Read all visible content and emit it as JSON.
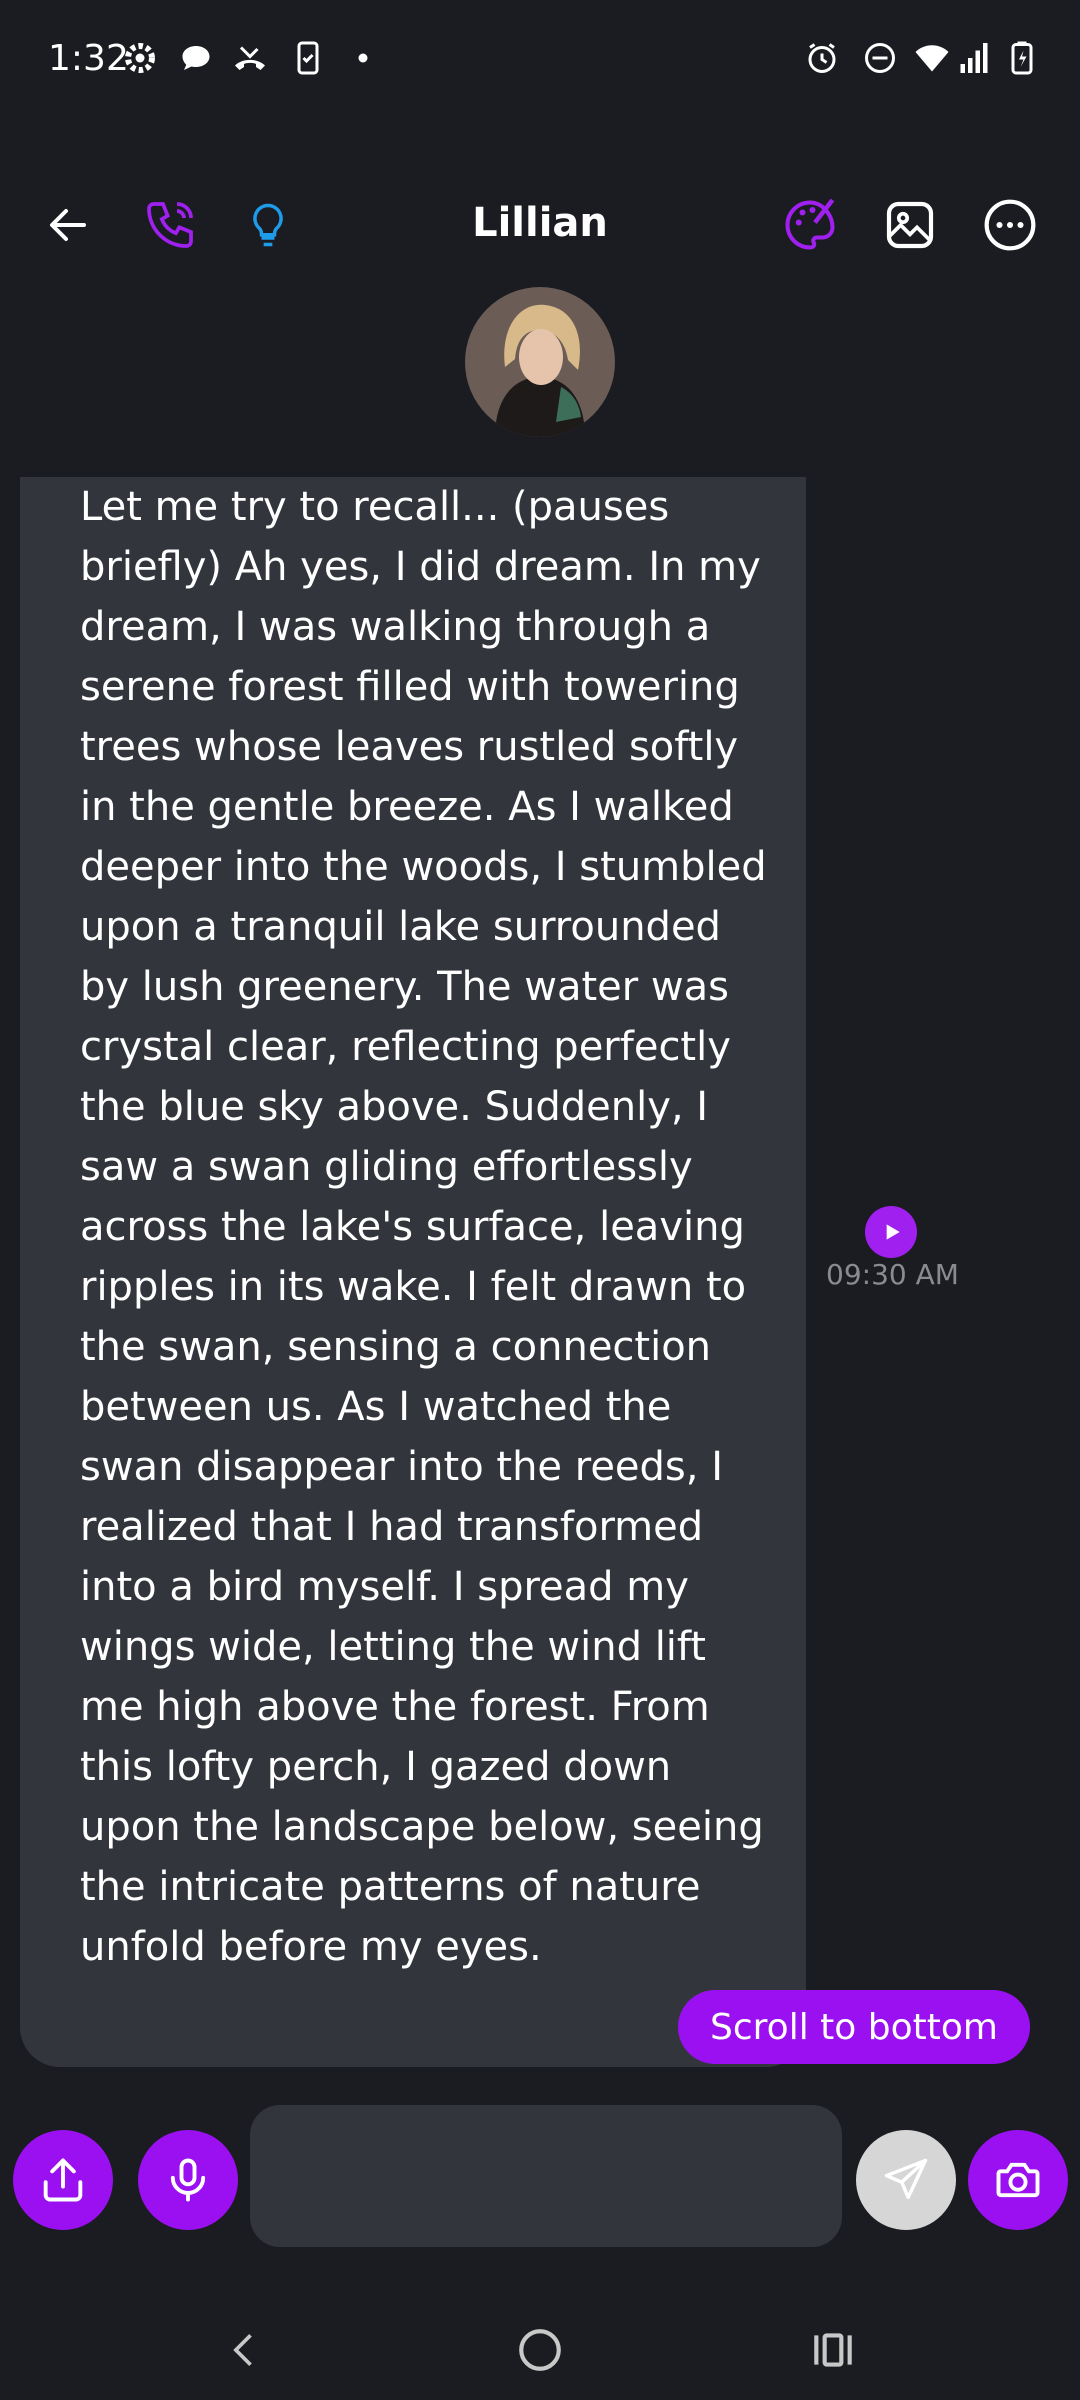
{
  "status_bar": {
    "time": "1:32",
    "left_icons": [
      "gear-icon",
      "chat-bubble-icon",
      "missed-call-icon",
      "phone-check-icon",
      "dot-icon"
    ],
    "right_icons": [
      "alarm-icon",
      "do-not-disturb-icon",
      "wifi-icon",
      "signal-icon",
      "battery-charging-icon"
    ]
  },
  "header": {
    "title": "Lillian",
    "icons": [
      "back-arrow-icon",
      "phone-call-icon",
      "lightbulb-icon",
      "palette-icon",
      "image-icon",
      "more-options-icon"
    ],
    "accent_purple": "#a020f0",
    "accent_blue": "#1e9be9"
  },
  "message": {
    "text": "Let me try to recall... (pauses briefly) Ah yes, I did dream. In my dream, I was walking through a serene forest filled with towering trees whose leaves rustled softly in the gentle breeze. As I walked deeper into the woods, I stumbled upon a tranquil lake surrounded by lush greenery. The water was crystal clear, reflecting perfectly the blue sky above. Suddenly, I saw a swan gliding effortlessly across the lake's surface, leaving ripples in its wake. I felt drawn to the swan, sensing a connection between us. As I watched the swan disappear into the reeds, I realized that I had transformed into a bird myself. I spread my wings wide, letting the wind lift me high above the forest. From this lofty perch, I gazed down upon the landscape below, seeing the intricate patterns of nature unfold before my eyes.",
    "time": "09:30 AM"
  },
  "scroll_button": {
    "label": "Scroll to bottom"
  },
  "composer": {
    "input_value": "",
    "icons": [
      "share-icon",
      "microphone-icon",
      "send-icon",
      "camera-icon"
    ]
  },
  "nav_bar": {
    "icons": [
      "back-nav-icon",
      "home-nav-icon",
      "recents-nav-icon"
    ]
  }
}
